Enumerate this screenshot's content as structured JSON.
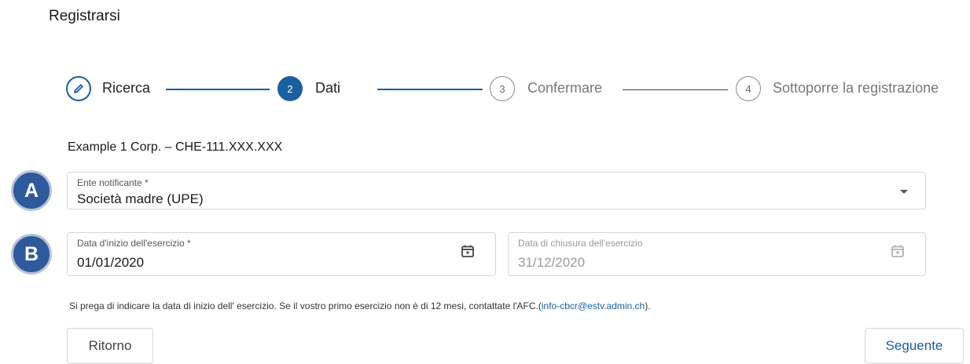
{
  "page": {
    "title": "Registrarsi"
  },
  "stepper": {
    "steps": [
      {
        "number": "",
        "label": "Ricerca",
        "state": "done"
      },
      {
        "number": "2",
        "label": "Dati",
        "state": "active"
      },
      {
        "number": "3",
        "label": "Confermare",
        "state": "todo"
      },
      {
        "number": "4",
        "label": "Sottoporre la registrazione",
        "state": "todo"
      }
    ]
  },
  "company": "Example 1 Corp. – CHE-111.XXX.XXX",
  "badges": {
    "a": "A",
    "b": "B"
  },
  "form": {
    "reporting_entity": {
      "label": "Ente notificante *",
      "value": "Società madre (UPE)"
    },
    "start_date": {
      "label": "Data d'inizio dell'esercizio *",
      "value": "01/01/2020"
    },
    "end_date": {
      "label": "Data di chiusura dell'esercizio",
      "value": "31/12/2020"
    }
  },
  "hint": {
    "text": "Si prega di indicare la data di inizio dell' esercizio. Se il vostro primo esercizio non è di 12 mesi, contattate l'AFC.(",
    "email": "info-cbcr@estv.admin.ch",
    "suffix": ")."
  },
  "buttons": {
    "back": "Ritorno",
    "next": "Seguente"
  },
  "colors": {
    "primary": "#1b5f9e",
    "badge": "#2e5a9b"
  }
}
